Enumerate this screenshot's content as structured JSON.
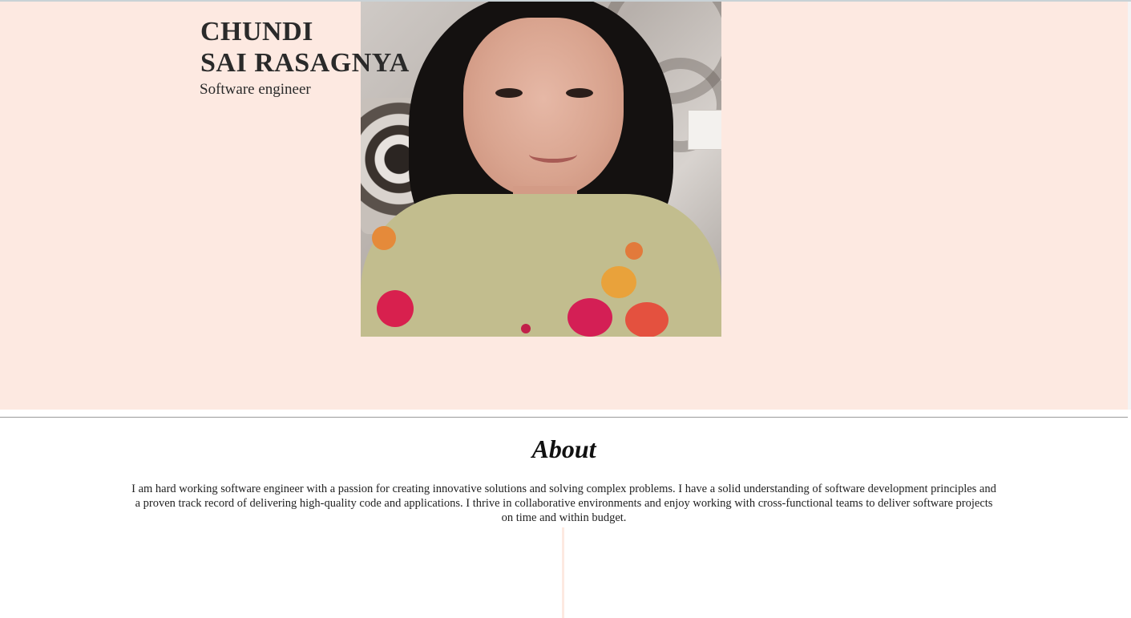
{
  "hero": {
    "name_line1": "CHUNDI",
    "name_line2": "SAI RASAGNYA",
    "role": "Software engineer",
    "background_color": "#fde9e1"
  },
  "about": {
    "title": "About",
    "text": "I am hard working software engineer with a passion for creating innovative solutions and solving complex problems. I have a solid understanding of software development principles and a proven track record of delivering high-quality code and applications. I thrive in collaborative environments and enjoy working with cross-functional teams to deliver software projects on time and within budget."
  }
}
